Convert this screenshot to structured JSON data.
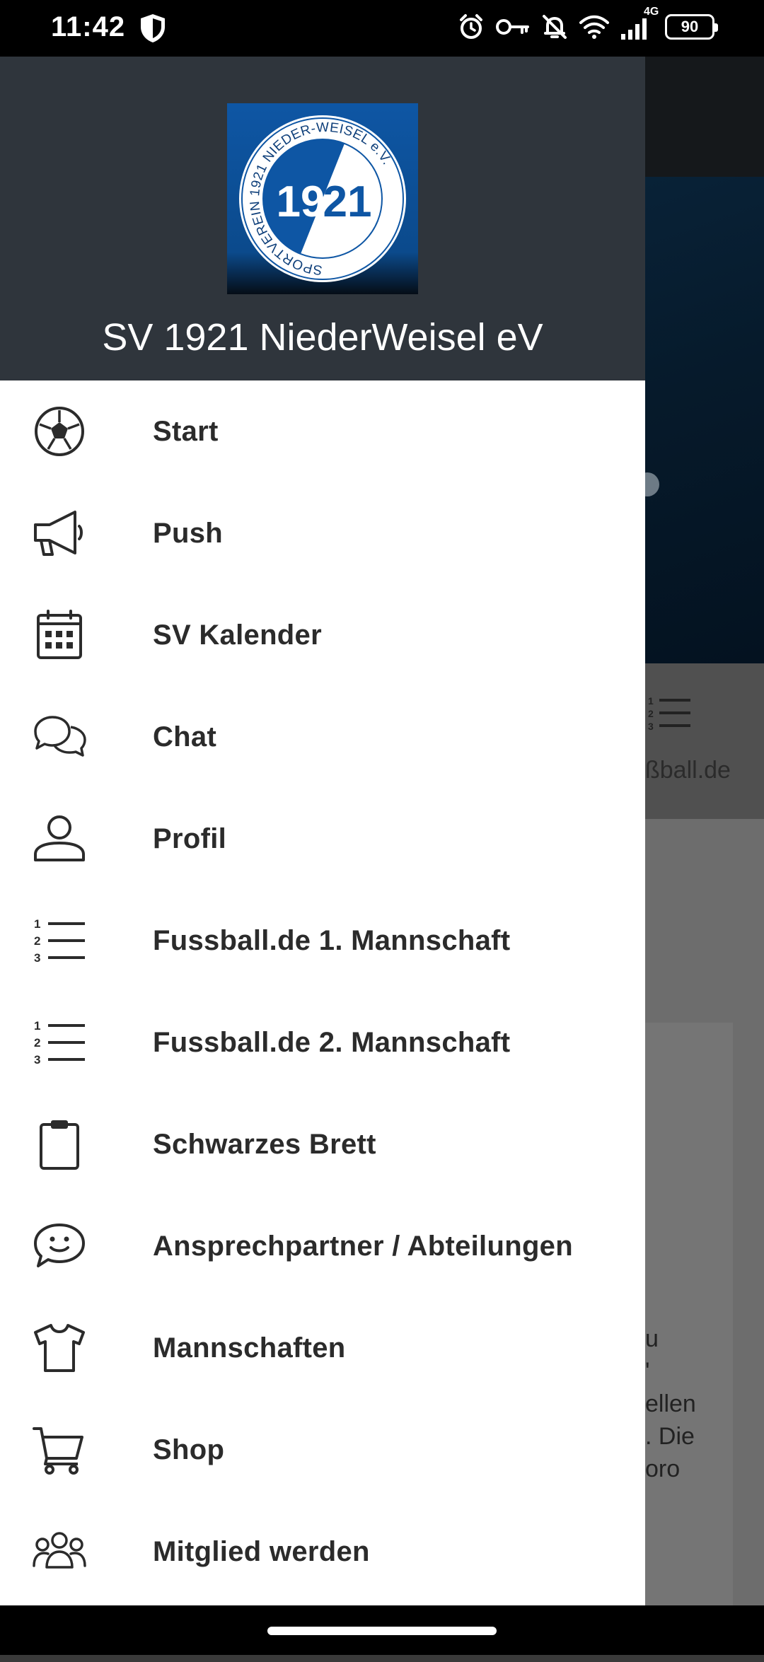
{
  "status_bar": {
    "time": "11:42",
    "network": "4G",
    "battery": "90"
  },
  "drawer": {
    "club_name": "SV 1921 NiederWeisel eV",
    "logo": {
      "ring_text": "SPORTVEREIN 1921 NIEDER-WEISEL e.V.",
      "year_left": "19",
      "year_right": "21",
      "colors": {
        "blue": "#0e56a4",
        "dark": "#0a1a2a",
        "white": "#ffffff"
      }
    },
    "items": [
      {
        "label": "Start",
        "icon": "soccer-ball-icon"
      },
      {
        "label": "Push",
        "icon": "megaphone-icon"
      },
      {
        "label": "SV Kalender",
        "icon": "calendar-icon"
      },
      {
        "label": "Chat",
        "icon": "chat-bubbles-icon"
      },
      {
        "label": "Profil",
        "icon": "user-icon"
      },
      {
        "label": "Fussball.de 1. Mannschaft",
        "icon": "numbered-list-icon"
      },
      {
        "label": "Fussball.de 2. Mannschaft",
        "icon": "numbered-list-icon"
      },
      {
        "label": "Schwarzes Brett",
        "icon": "clipboard-icon"
      },
      {
        "label": "Ansprechpartner / Abteilungen",
        "icon": "smiley-chat-icon"
      },
      {
        "label": "Mannschaften",
        "icon": "shirt-icon"
      },
      {
        "label": "Shop",
        "icon": "cart-icon"
      },
      {
        "label": "Mitglied werden",
        "icon": "group-icon"
      }
    ]
  },
  "background": {
    "tile_text": "ßball.de",
    "card_lines": [
      "u",
      "'",
      "",
      "ellen",
      ". Die",
      "oro"
    ]
  },
  "colors": {
    "drawer_header": "#2f353c",
    "drawer_bg": "#ffffff",
    "text": "#2b2b2b"
  }
}
